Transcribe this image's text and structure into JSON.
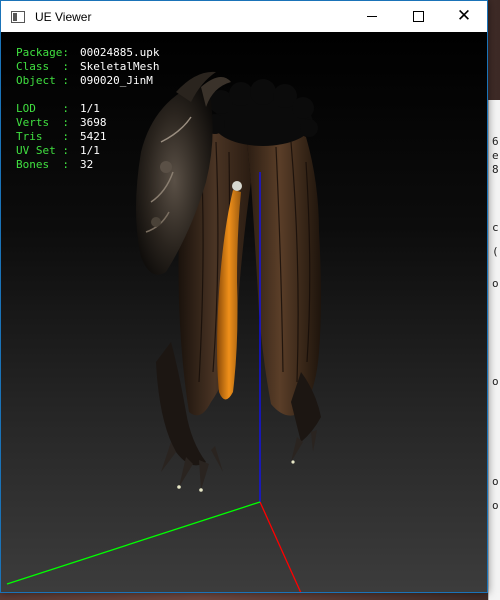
{
  "window": {
    "title": "UE Viewer",
    "icon": "app-window-icon",
    "buttons": {
      "minimize": "minimize-icon",
      "maximize": "maximize-icon",
      "close": "close-icon"
    }
  },
  "info": {
    "package": {
      "label": "Package:",
      "value": "00024885.upk"
    },
    "class": {
      "label": "Class  :",
      "value": "SkeletalMesh"
    },
    "object": {
      "label": "Object :",
      "value": "090020_JinM"
    }
  },
  "stats": {
    "lod": {
      "label": "LOD    :",
      "value": "1/1"
    },
    "verts": {
      "label": "Verts  :",
      "value": "3698"
    },
    "tris": {
      "label": "Tris   :",
      "value": "5421"
    },
    "uvset": {
      "label": "UV Set :",
      "value": "1/1"
    },
    "bones": {
      "label": "Bones  :",
      "value": "32"
    }
  },
  "colors": {
    "label_green": "#40e040",
    "value_white": "#ffffff",
    "axis_x": "#ff0000",
    "axis_y": "#00ff00",
    "axis_z": "#0000ff",
    "window_border": "#1a73b8"
  },
  "background_window_fragments": [
    "6",
    "e",
    "8",
    "c",
    "(",
    "o",
    "o",
    "o",
    "o"
  ]
}
